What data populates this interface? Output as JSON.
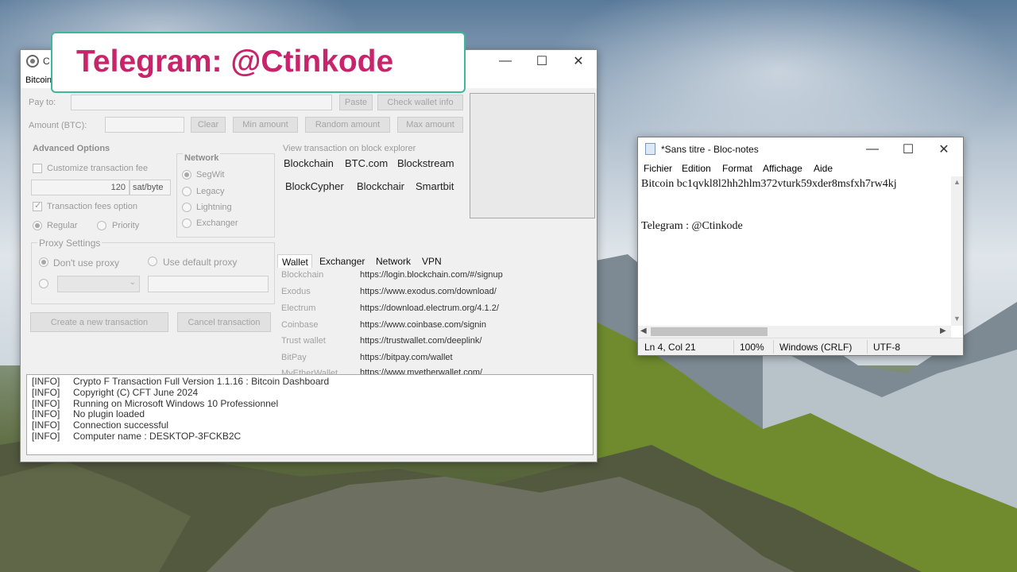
{
  "banner": {
    "text": "Telegram: @Ctinkode"
  },
  "app": {
    "title": "C",
    "menu": "Bitcoin",
    "pay_to_label": "Pay to:",
    "amount_label": "Amount (BTC):",
    "paste": "Paste",
    "check_wallet": "Check wallet info",
    "clear": "Clear",
    "min_amount": "Min amount",
    "random_amount": "Random amount",
    "max_amount": "Max amount",
    "advanced": {
      "title": "Advanced Options",
      "customize_fee": "Customize transaction fee",
      "fee_value": "120",
      "fee_unit": "sat/byte",
      "fees_option": "Transaction fees option",
      "regular": "Regular",
      "priority": "Priority"
    },
    "network": {
      "title": "Network",
      "options": [
        "SegWit",
        "Legacy",
        "Lightning",
        "Exchanger"
      ]
    },
    "proxy": {
      "title": "Proxy Settings",
      "dont_use": "Don't use proxy",
      "use_default": "Use default proxy"
    },
    "create_tx": "Create a new transaction",
    "cancel_tx": "Cancel transaction",
    "explorer": {
      "title": "View transaction on block explorer",
      "links": [
        "Blockchain",
        "BTC.com",
        "Blockstream",
        "BlockCypher",
        "Blockchair",
        "Smartbit"
      ]
    },
    "tabs": [
      "Wallet",
      "Exchanger",
      "Network",
      "VPN"
    ],
    "wallets": [
      {
        "name": "Blockchain",
        "url": "https://login.blockchain.com/#/signup"
      },
      {
        "name": "Exodus",
        "url": "https://www.exodus.com/download/"
      },
      {
        "name": "Electrum",
        "url": "https://download.electrum.org/4.1.2/"
      },
      {
        "name": "Coinbase",
        "url": "https://www.coinbase.com/signin"
      },
      {
        "name": "Trust wallet",
        "url": "https://trustwallet.com/deeplink/"
      },
      {
        "name": "BitPay",
        "url": "https://bitpay.com/wallet"
      },
      {
        "name": "MyEtherWallet",
        "url": "https://www.myetherwallet.com/"
      }
    ],
    "log": [
      {
        "tag": "[INFO]",
        "msg": "Crypto F Transaction Full Version 1.1.16 : Bitcoin Dashboard"
      },
      {
        "tag": "[INFO]",
        "msg": "Copyright (C) CFT June 2024"
      },
      {
        "tag": "[INFO]",
        "msg": "Running on Microsoft Windows 10 Professionnel"
      },
      {
        "tag": "[INFO]",
        "msg": "No plugin loaded"
      },
      {
        "tag": "[INFO]",
        "msg": "Connection successful"
      },
      {
        "tag": "[INFO]",
        "msg": "Computer name : DESKTOP-3FCKB2C"
      }
    ]
  },
  "notepad": {
    "title": "*Sans titre - Bloc-notes",
    "menu": [
      "Fichier",
      "Edition",
      "Format",
      "Affichage",
      "Aide"
    ],
    "lines": [
      "Bitcoin bc1qvkl8l2hh2hlm372vturk59xder8msfxh7rw4kj",
      "",
      "",
      "Telegram : @Ctinkode"
    ],
    "status": {
      "position": "Ln 4, Col 21",
      "zoom": "100%",
      "eol": "Windows (CRLF)",
      "encoding": "UTF-8"
    }
  },
  "window_controls": {
    "minimize": "—",
    "maximize": "☐",
    "close": "✕"
  }
}
